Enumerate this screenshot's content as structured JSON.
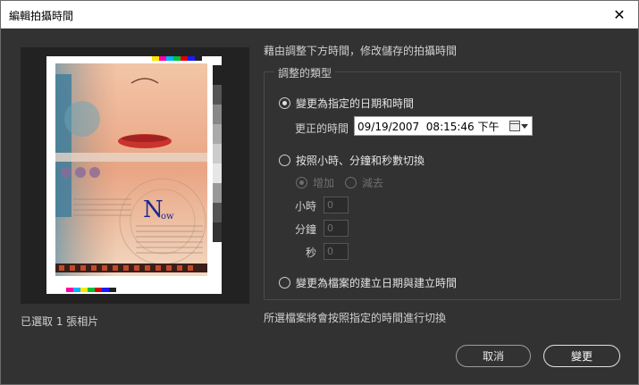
{
  "window": {
    "title": "編輯拍攝時間"
  },
  "preview": {
    "selected_count": "已選取 1 張相片"
  },
  "description": "藉由調整下方時間，修改儲存的拍攝時間",
  "adjust_group": {
    "legend": "調整的類型",
    "option_specific": {
      "label": "變更為指定的日期和時間",
      "checked": true
    },
    "corrected_time": {
      "label": "更正的時間",
      "value": "09/19/2007  08:15:46 下午"
    },
    "option_shift": {
      "label": "按照小時、分鐘和秒數切換",
      "checked": false
    },
    "add_label": "增加",
    "subtract_label": "減去",
    "hours": {
      "label": "小時",
      "value": "0"
    },
    "minutes": {
      "label": "分鐘",
      "value": "0"
    },
    "seconds": {
      "label": "秒",
      "value": "0"
    },
    "option_file": {
      "label": "變更為檔案的建立日期與建立時間",
      "checked": false
    }
  },
  "footer_note": "所選檔案將會按照指定的時間進行切換",
  "buttons": {
    "cancel": "取消",
    "change": "變更"
  },
  "photo_text": {
    "initial": "N",
    "initial_suffix": "ow"
  },
  "colors": {
    "dialog_bg": "#323232",
    "titlebar_bg": "#ffffff",
    "preview_bg": "#222222"
  }
}
